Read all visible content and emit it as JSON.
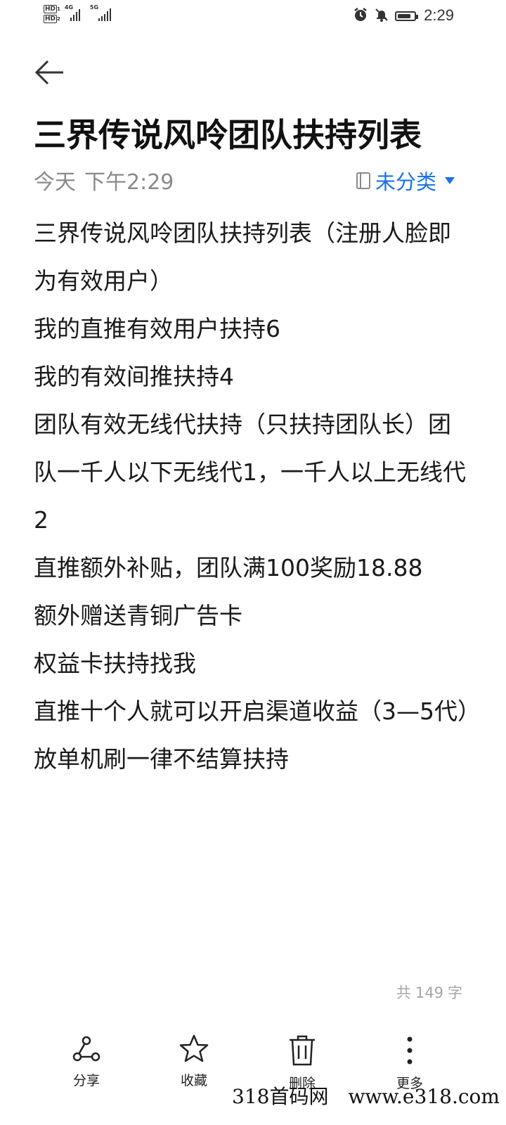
{
  "status_bar": {
    "sim1": "HD",
    "sim2": "HD",
    "net1": "4G",
    "net2": "5G",
    "time": "2:29",
    "battery_level": 0.8,
    "icons": [
      "alarm-icon",
      "mute-bell-icon",
      "battery-icon"
    ]
  },
  "header": {
    "back_icon": "arrow-left-icon",
    "title": "三界传说风呤团队扶持列表",
    "date": "今天",
    "time": "下午2:29",
    "category_icon": "notebook-icon",
    "category": "未分类"
  },
  "note": {
    "lines": [
      "三界传说风呤团队扶持列表（注册人脸即为有效用户）",
      "我的直推有效用户扶持6",
      "我的有效间推扶持4",
      "团队有效无线代扶持（只扶持团队长）团队一千人以下无线代1，一千人以上无线代2",
      "直推额外补贴，团队满100奖励18.88",
      "额外赠送青铜广告卡",
      "权益卡扶持找我",
      "直推十个人就可以开启渠道收益（3—5代）",
      "放单机刷一律不结算扶持"
    ]
  },
  "word_count": {
    "prefix": "共",
    "count": "149",
    "suffix": "字"
  },
  "toolbar": {
    "share_label": "分享",
    "favorite_label": "收藏",
    "delete_label": "删除",
    "more_label": "更多"
  },
  "watermark": {
    "site_name": "318首码网",
    "url": "www.e318.com"
  }
}
